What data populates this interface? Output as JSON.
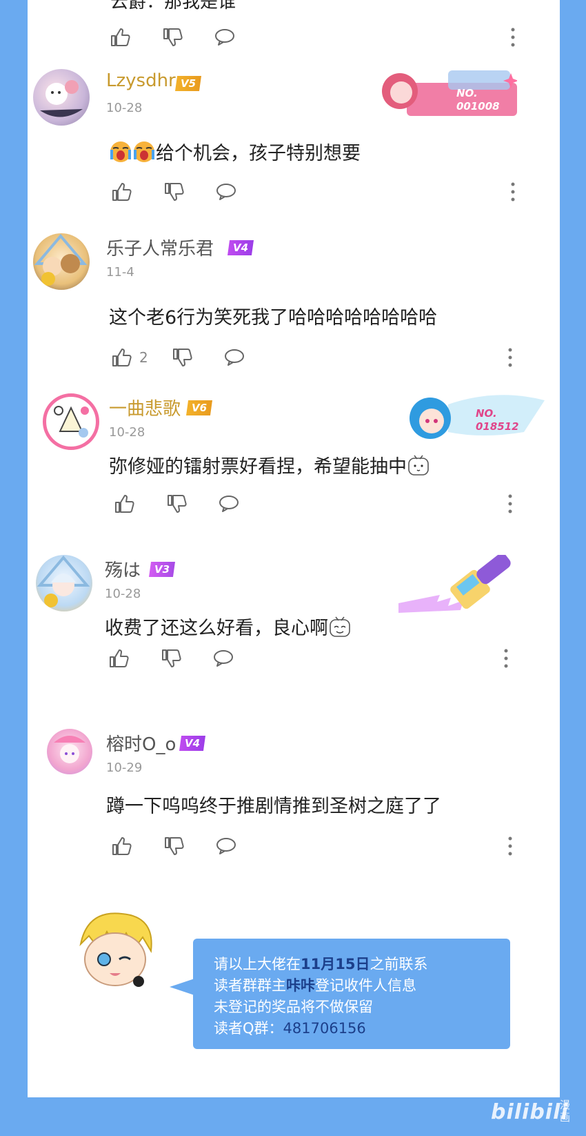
{
  "top_partial": {
    "text": "云爵：那我是谁"
  },
  "comments": [
    {
      "username": "Lzysdhr",
      "level": "V5",
      "date": "10-28",
      "text": "给个机会，孩子特别想要",
      "fan_no": "NO.\n001008",
      "likes": ""
    },
    {
      "username": "乐子人常乐君",
      "level": "V4",
      "date": "11-4",
      "text": "这个老6行为笑死我了哈哈哈哈哈哈哈哈",
      "likes": "2"
    },
    {
      "username": "一曲悲歌",
      "level": "V6",
      "date": "10-28",
      "text": "弥修娅的镭射票好看捏，希望能抽中",
      "fan_no": "NO.\n018512",
      "likes": ""
    },
    {
      "username": "殇は",
      "level": "V3",
      "date": "10-28",
      "text": "收费了还这么好看，良心啊",
      "likes": ""
    },
    {
      "username": "榕时O_o",
      "level": "V4",
      "date": "10-29",
      "text": "蹲一下呜呜终于推剧情推到圣树之庭了了",
      "likes": ""
    }
  ],
  "notice": {
    "line1_a": "请以上大佬在",
    "line1_date": "11月15日",
    "line1_b": "之前联系",
    "line2_a": "读者群群主",
    "line2_name": "咔咔",
    "line2_b": "登记收件人信息",
    "line3": "未登记的奖品将不做保留",
    "line4_label": "读者Q群",
    "line4_sep": "：",
    "line4_num": "481706156"
  },
  "watermark": {
    "brand": "bilibili",
    "sub": "漫画"
  },
  "colors": {
    "page_bg": "#6aaaf0",
    "panel_bg": "#ffffff",
    "gold_name": "#c89a2e",
    "highlight": "#1c3f8a"
  },
  "icons": [
    "thumb-up-icon",
    "thumb-down-icon",
    "reply-icon",
    "more-icon"
  ]
}
